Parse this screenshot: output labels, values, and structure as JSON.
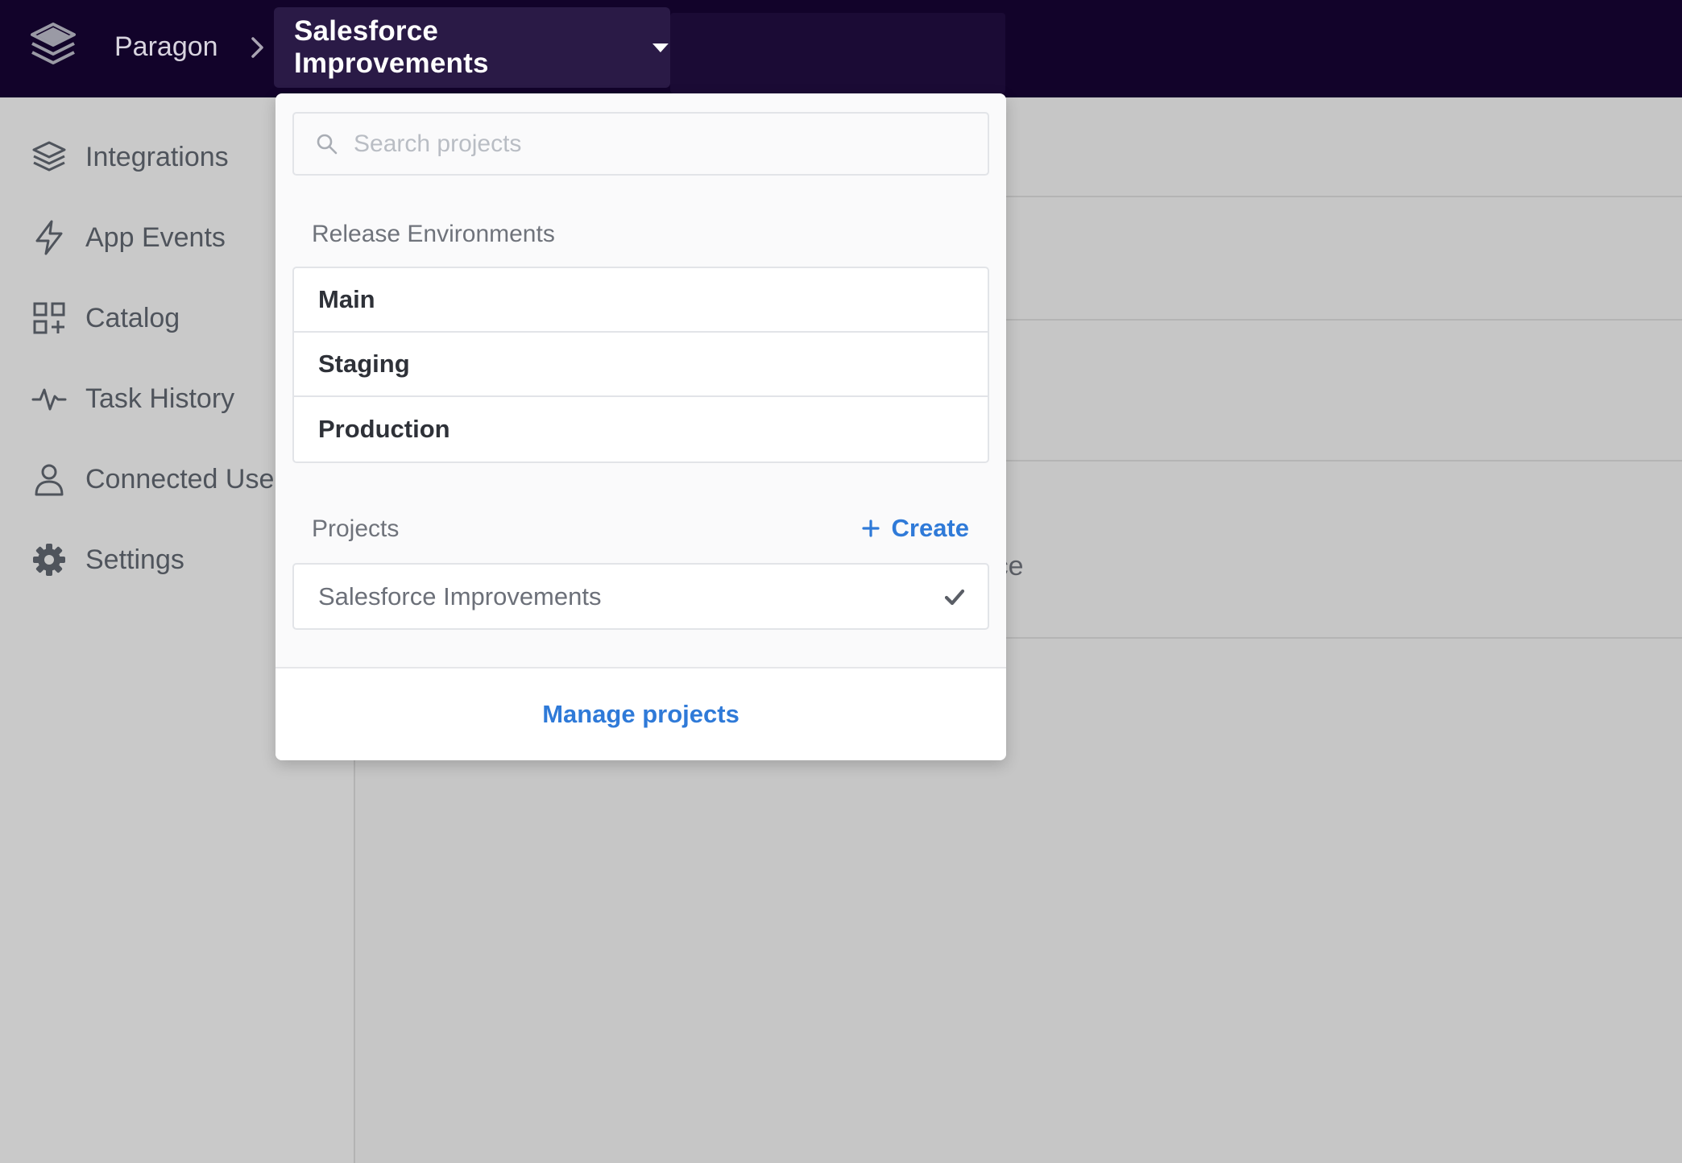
{
  "header": {
    "org_name": "Paragon",
    "current_project": "Salesforce Improvements"
  },
  "sidebar": {
    "items": [
      {
        "label": "Integrations",
        "icon": "layers-icon"
      },
      {
        "label": "App Events",
        "icon": "bolt-icon"
      },
      {
        "label": "Catalog",
        "icon": "grid-plus-icon"
      },
      {
        "label": "Task History",
        "icon": "activity-icon"
      },
      {
        "label": "Connected Use",
        "icon": "user-icon"
      },
      {
        "label": "Settings",
        "icon": "gear-icon"
      }
    ]
  },
  "main": {
    "ghost_text": "force"
  },
  "dropdown": {
    "search_placeholder": "Search projects",
    "release_environments_title": "Release Environments",
    "environments": [
      "Main",
      "Staging",
      "Production"
    ],
    "projects_title": "Projects",
    "create_label": "Create",
    "projects": [
      {
        "label": "Salesforce Improvements",
        "selected": true
      }
    ],
    "manage_label": "Manage projects"
  },
  "colors": {
    "topbar": "#12032a",
    "accent_link": "#2f7ad8",
    "overlay_gray": "#c6c6c6"
  }
}
